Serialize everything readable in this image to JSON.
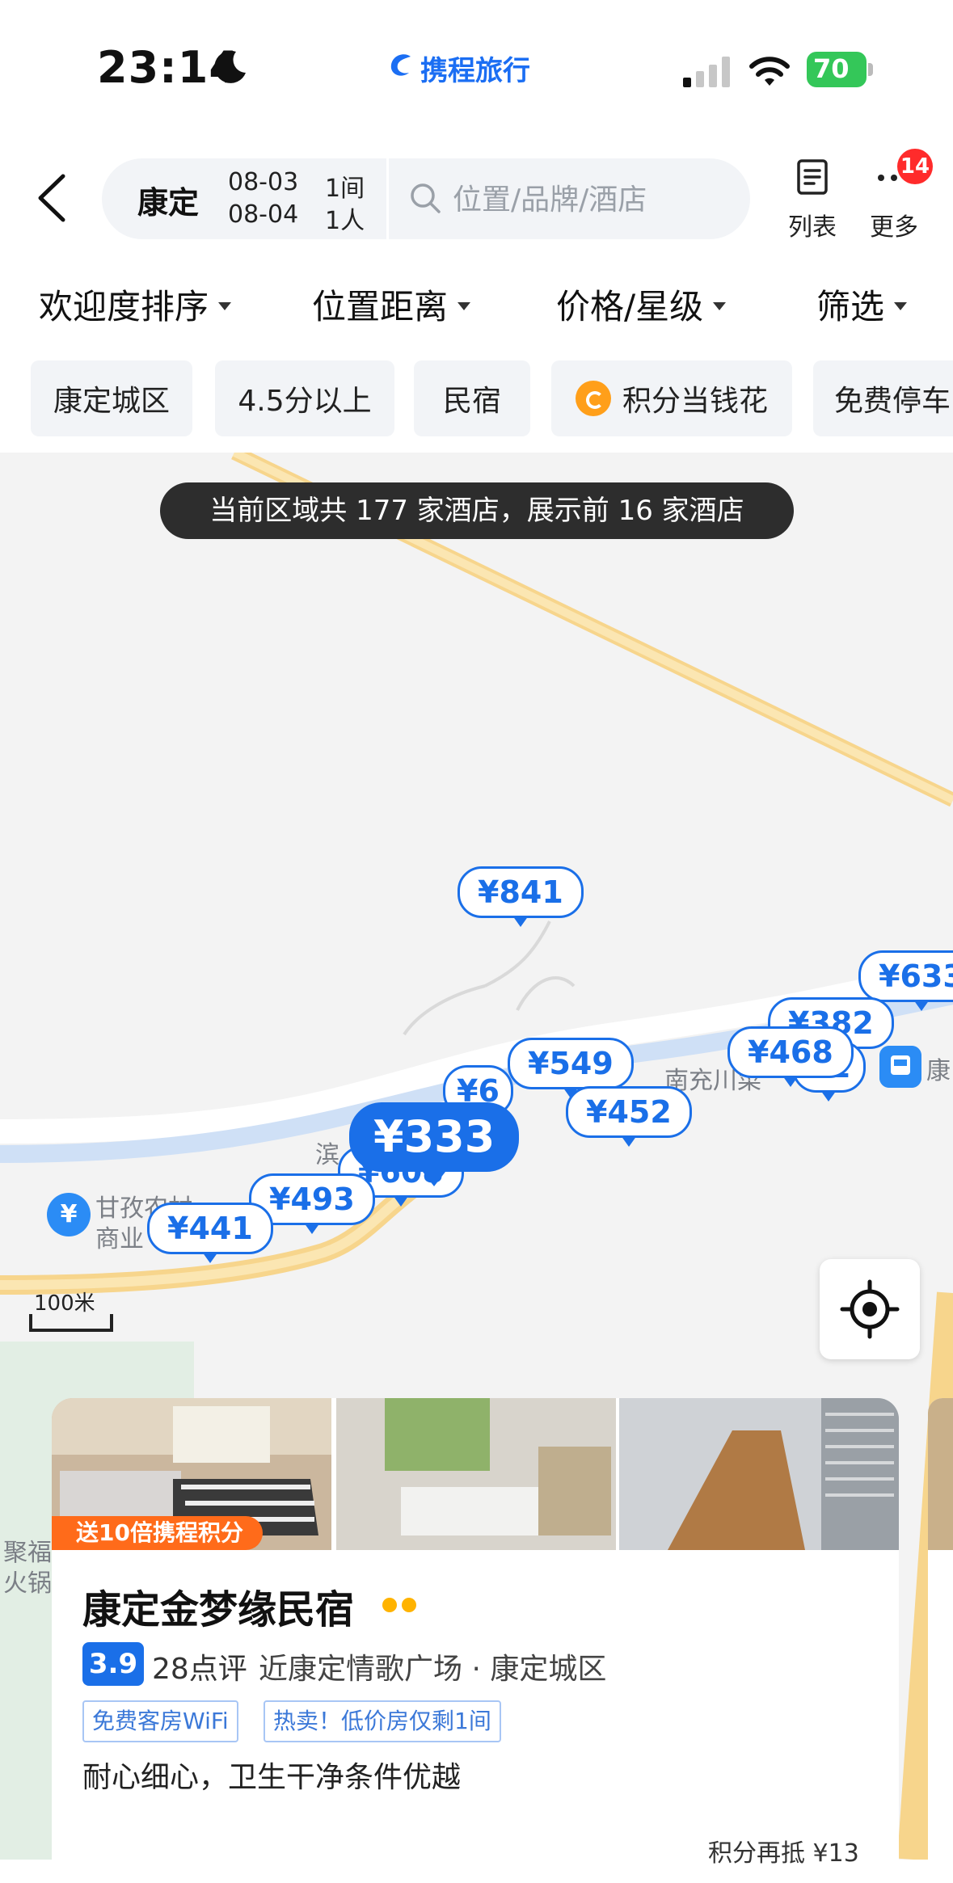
{
  "status_bar": {
    "time": "23:14",
    "app_title": "携程旅行",
    "battery": "70"
  },
  "search": {
    "city": "康定",
    "checkin": "08-03",
    "checkout": "08-04",
    "rooms": "1间",
    "guests": "1人",
    "placeholder": "位置/品牌/酒店"
  },
  "header_actions": {
    "list_label": "列表",
    "more_label": "更多",
    "notification_count": "14"
  },
  "filters": [
    "欢迎度排序",
    "位置距离",
    "价格/星级",
    "筛选"
  ],
  "chips": [
    "康定城区",
    "4.5分以上",
    "民宿",
    "积分当钱花",
    "免费停车"
  ],
  "map": {
    "toast": "当前区域共 177 家酒店，展示前 16 家酒店",
    "pins": [
      "¥841",
      "¥633",
      "¥382",
      "¥468",
      "¥549",
      "¥452",
      "¥333",
      "¥608",
      "¥493",
      "¥441",
      "¥6",
      "¥1"
    ],
    "labels": [
      "南充川菜",
      "康",
      "滨",
      "甘孜农村",
      "商业",
      "聚福",
      "火锅"
    ],
    "scale": "100米"
  },
  "hotel_card": {
    "promo": "送10倍携程积分",
    "name": "康定金梦缘民宿",
    "score": "3.9",
    "reviews": "28点评",
    "location": "近康定情歌广场 · 康定城区",
    "tags": [
      "免费客房WiFi",
      "热卖！低价房仅剩1间"
    ],
    "description": "耐心细心，卫生干净条件优越",
    "points_offset": "积分再抵 ¥13"
  },
  "colors": {
    "brand": "#1a6fe8",
    "promo": "#ff6b1a",
    "badge": "#ff2b2b",
    "battery": "#34c759"
  }
}
